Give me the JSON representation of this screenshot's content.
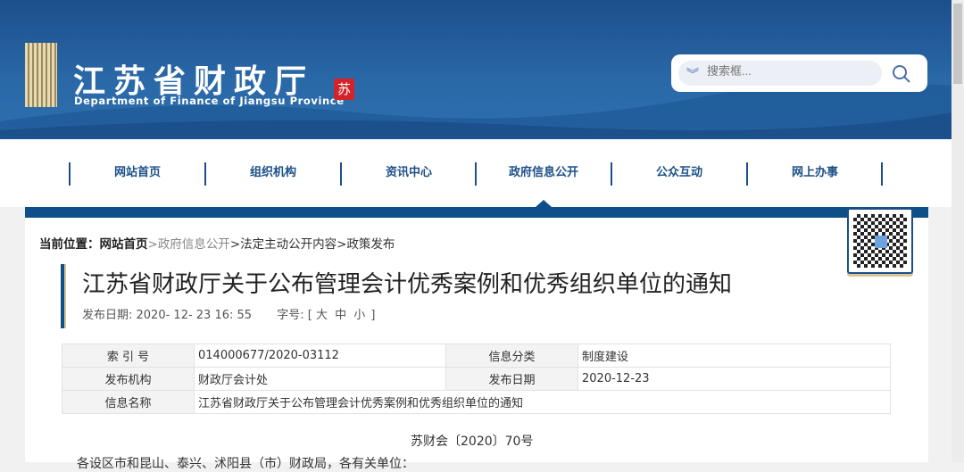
{
  "header": {
    "title_cn": "江苏省财政厅",
    "title_en": "Department of Finance of Jiangsu Province",
    "seal": "苏",
    "search_placeholder": "搜索框..."
  },
  "nav": [
    "网站首页",
    "组织机构",
    "资讯中心",
    "政府信息公开",
    "公众互动",
    "网上办事"
  ],
  "breadcrumb": {
    "label": "当前位置：",
    "home": "网站首页",
    "items": [
      ">政府信息公开",
      ">法定主动公开内容",
      ">政策发布"
    ]
  },
  "article": {
    "title": "江苏省财政厅关于公布管理会计优秀案例和优秀组织单位的通知",
    "date": "发布日期:  2020- 12- 23   16: 55",
    "font_label": "字号: [",
    "font_large": "大",
    "font_medium": "中",
    "font_small": "小",
    "font_end": "]",
    "info": [
      [
        "索 引 号",
        "014000677/2020-03112",
        "信息分类",
        "制度建设"
      ],
      [
        "发布机构",
        "财政厅会计处",
        "发布日期",
        "2020-12-23"
      ],
      [
        "信息名称",
        "江苏省财政厅关于公布管理会计优秀案例和优秀组织单位的通知"
      ]
    ],
    "doc_no": "苏财会〔2020〕70号",
    "salutation": "各设区市和昆山、泰兴、沭阳县（市）财政局，各有关单位："
  }
}
